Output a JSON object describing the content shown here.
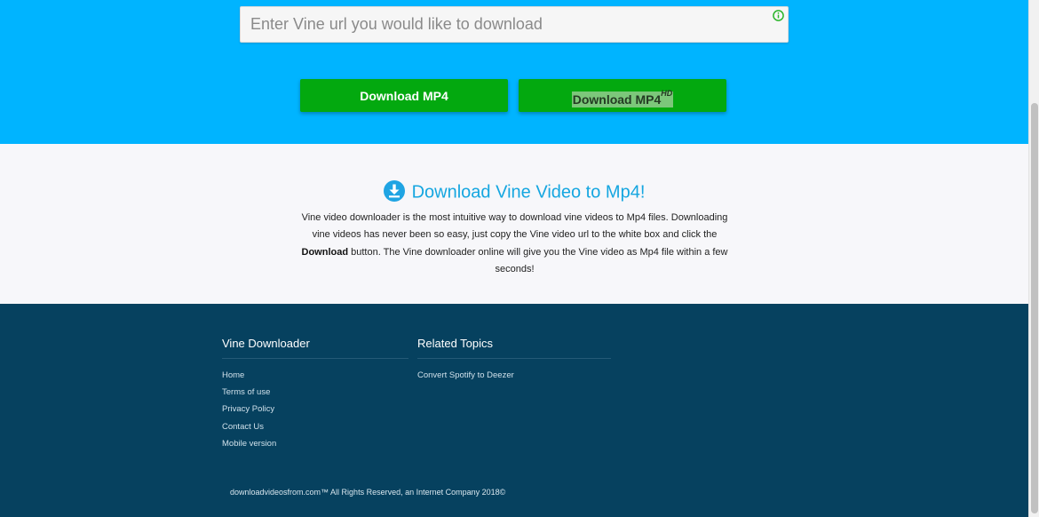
{
  "search": {
    "placeholder": "Enter Vine url you would like to download",
    "value": ""
  },
  "buttons": {
    "mp4": "Download MP4",
    "mp4_hd": "Download MP4",
    "hd_badge": "HD"
  },
  "intro": {
    "title": "Download Vine Video to Mp4!",
    "text_part1": "Vine video downloader is the most intuitive way to download vine videos to Mp4 files. Downloading vine videos has never been so easy, just copy the Vine video url to the white box and click the ",
    "text_bold": "Download",
    "text_part2": " button. The Vine downloader online will give you the Vine video as Mp4 file within a few seconds!"
  },
  "footer": {
    "col1": {
      "heading": "Vine Downloader",
      "links": [
        "Home",
        "Terms of use",
        "Privacy Policy",
        "Contact Us",
        "Mobile version"
      ]
    },
    "col2": {
      "heading": "Related Topics",
      "links": [
        "Convert Spotify to Deezer"
      ]
    },
    "copyright": "downloadvideosfrom.com™ All Rights Reserved, an Internet Company 2018©"
  },
  "icons": {
    "info": "info-icon",
    "download": "download-circle-icon"
  },
  "colors": {
    "hero_bg": "#00b4ff",
    "button_green": "#03a90f",
    "title_blue": "#15a6e0",
    "footer_bg": "#06415f"
  }
}
